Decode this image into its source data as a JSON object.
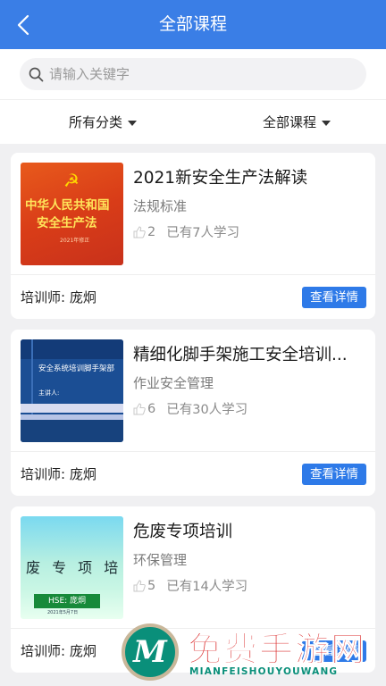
{
  "header": {
    "title": "全部课程"
  },
  "search": {
    "placeholder": "请输入关键字"
  },
  "filters": [
    {
      "label": "所有分类"
    },
    {
      "label": "全部课程"
    }
  ],
  "courses": [
    {
      "title": "2021新安全生产法解读",
      "category": "法规标准",
      "likes": "2",
      "learners": "已有7人学习",
      "instructor": "培训师: 庞炯",
      "button": "查看详情",
      "thumb": {
        "line1": "中华人民共和国",
        "line2": "安全生产法",
        "edition": "2021年修正"
      }
    },
    {
      "title": "精细化脚手架施工安全培训...",
      "category": "作业安全管理",
      "likes": "6",
      "learners": "已有30人学习",
      "instructor": "培训师: 庞炯",
      "button": "查看详情",
      "thumb": {
        "title": "安全系统培训脚手架部",
        "speaker": "主讲人:"
      }
    },
    {
      "title": "危废专项培训",
      "category": "环保管理",
      "likes": "5",
      "learners": "已有14人学习",
      "instructor": "培训师: 庞炯",
      "button": "查看详情",
      "thumb": {
        "text": "废 专 项 培 训",
        "badge": "HSE: 庞炯",
        "date": "2021年5月7日"
      }
    }
  ],
  "watermark": {
    "logo": "M",
    "text": "免费手游网",
    "sub": "MIANFEISHOUYOUWANG"
  },
  "colors": {
    "primary": "#3a7ee6",
    "button": "#2e7ae8",
    "background": "#f0f0f2"
  }
}
